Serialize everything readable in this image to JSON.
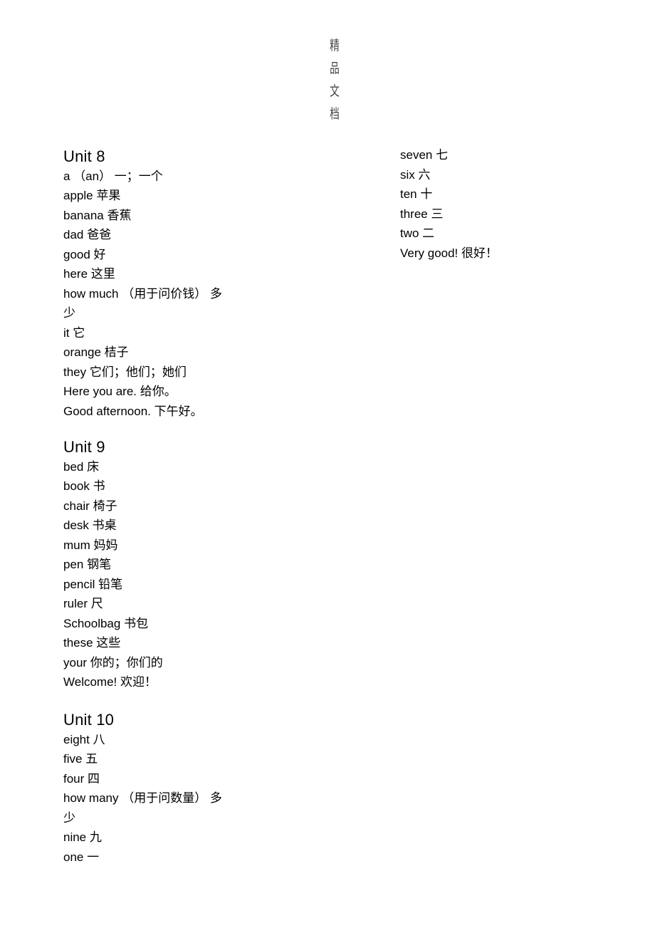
{
  "page": {
    "watermark_chars": [
      "精",
      "品",
      "文",
      "档"
    ],
    "background_color": "#ffffff",
    "text_color": "#000000"
  },
  "left_column": {
    "units": [
      {
        "title": "Unit 8",
        "entries": [
          "a （an） 一；一个",
          "apple 苹果",
          "banana 香蕉",
          "dad 爸爸",
          "good 好",
          "here 这里",
          "how much （用于问价钱） 多少",
          "it 它",
          "orange 桔子",
          "they 它们；他们；她们",
          "Here you are. 给你。",
          "Good afternoon. 下午好。"
        ]
      },
      {
        "title": "Unit 9",
        "entries": [
          "bed 床",
          "book 书",
          "chair 椅子",
          "desk 书桌",
          "mum 妈妈",
          "pen 钢笔",
          "pencil 铅笔",
          "ruler 尺",
          "Schoolbag 书包",
          "these 这些",
          "your 你的；你们的",
          "Welcome! 欢迎！"
        ]
      },
      {
        "title": "Unit 10",
        "entries": [
          "eight 八",
          "five 五",
          "four 四",
          "how many （用于问数量） 多少",
          "nine 九",
          "one 一"
        ]
      }
    ]
  },
  "right_column": {
    "continuation_of": "Unit 10",
    "entries": [
      "seven 七",
      "six 六",
      "ten 十",
      "three 三",
      "two 二",
      "Very good! 很好！"
    ]
  }
}
